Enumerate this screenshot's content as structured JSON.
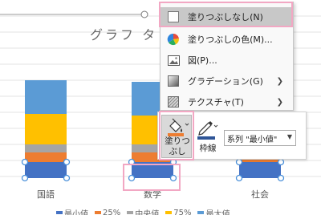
{
  "chart": {
    "title": "グラフ タ",
    "categories": [
      "国語",
      "数学",
      "社会"
    ]
  },
  "chart_data": {
    "type": "bar",
    "stacked": true,
    "title": "グラフ タ",
    "categories": [
      "国語",
      "数学",
      "社会"
    ],
    "series": [
      {
        "name": "最小値",
        "color": "#4472c4",
        "values": [
          20,
          20,
          20
        ]
      },
      {
        "name": "25%",
        "color": "#ed7d31",
        "values": [
          12,
          12,
          12
        ]
      },
      {
        "name": "中央値",
        "color": "#a5a5a5",
        "values": [
          10,
          10,
          null
        ]
      },
      {
        "name": "75%",
        "color": "#ffc000",
        "values": [
          38,
          36,
          null
        ]
      },
      {
        "name": "最大値",
        "color": "#5b9bd5",
        "values": [
          42,
          42,
          null
        ]
      }
    ],
    "grid": true,
    "legend": "bottom"
  },
  "legend": {
    "items": [
      {
        "label": "最小値",
        "color": "#4472c4"
      },
      {
        "label": "25%",
        "color": "#ed7d31"
      },
      {
        "label": "中央値",
        "color": "#a5a5a5"
      },
      {
        "label": "75%",
        "color": "#ffc000"
      },
      {
        "label": "最大値",
        "color": "#5b9bd5"
      }
    ]
  },
  "menu": {
    "items": [
      {
        "label": "塗りつぶしなし(N)",
        "icon": "no-fill-icon",
        "submenu": false,
        "highlighted": true
      },
      {
        "label": "塗りつぶしの色(M)...",
        "icon": "color-wheel-icon",
        "submenu": false
      },
      {
        "label": "図(P)...",
        "icon": "picture-icon",
        "submenu": false
      },
      {
        "label": "グラデーション(G)",
        "icon": "gradient-icon",
        "submenu": true
      },
      {
        "label": "テクスチャ(T)",
        "icon": "texture-icon",
        "submenu": true
      }
    ]
  },
  "mini_toolbar": {
    "fill_label_line1": "塗りつ",
    "fill_label_line2": "ぶし",
    "outline_label": "枠線",
    "series_selector": "系列 \"最小値\"",
    "fill_color": "#ed7d31",
    "outline_color": "#2f5597"
  }
}
